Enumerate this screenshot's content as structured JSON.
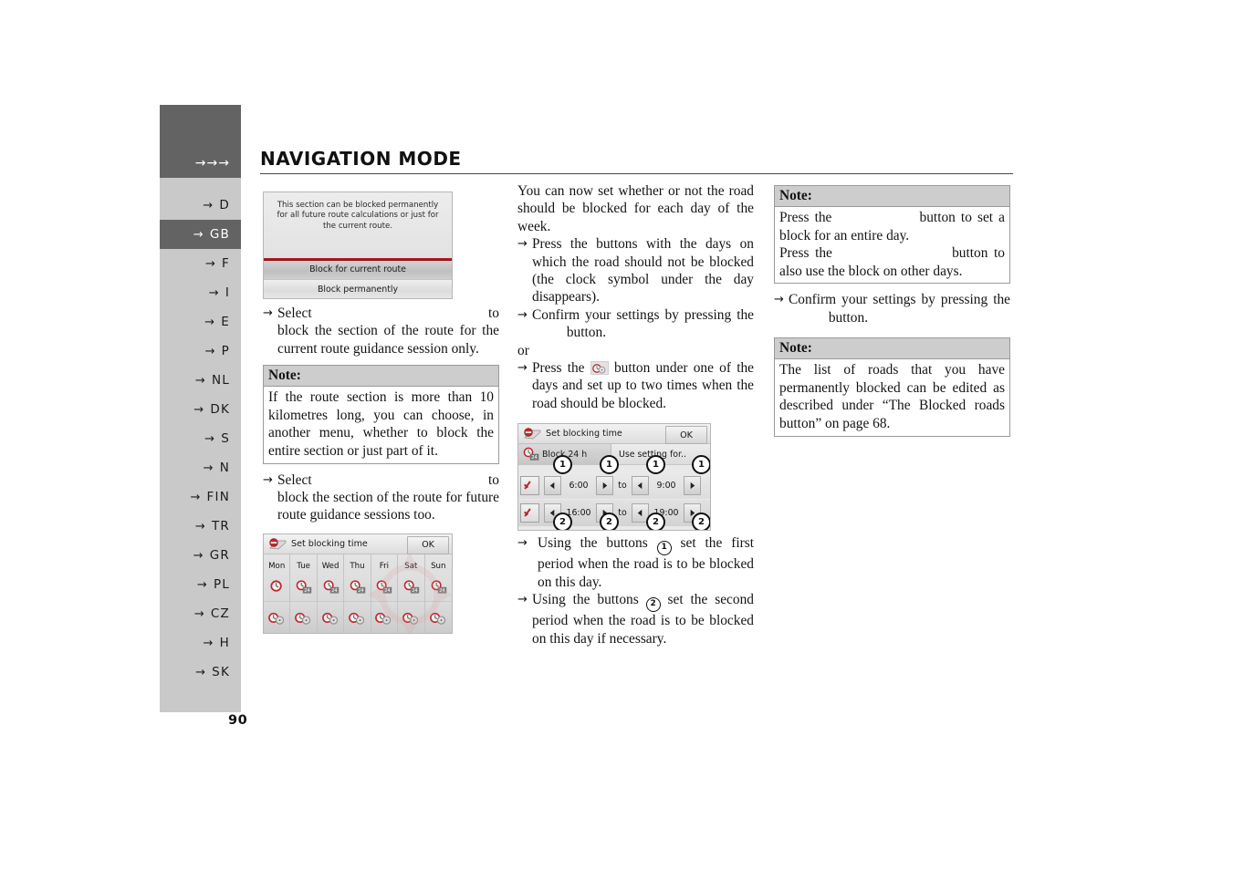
{
  "page": {
    "number": "90",
    "title": "NAVIGATION MODE",
    "header_arrows": "→→→"
  },
  "sidebar": {
    "languages": [
      {
        "code": "D",
        "active": false
      },
      {
        "code": "GB",
        "active": true
      },
      {
        "code": "F",
        "active": false
      },
      {
        "code": "I",
        "active": false
      },
      {
        "code": "E",
        "active": false
      },
      {
        "code": "P",
        "active": false
      },
      {
        "code": "NL",
        "active": false
      },
      {
        "code": "DK",
        "active": false
      },
      {
        "code": "S",
        "active": false
      },
      {
        "code": "N",
        "active": false
      },
      {
        "code": "FIN",
        "active": false
      },
      {
        "code": "TR",
        "active": false
      },
      {
        "code": "GR",
        "active": false
      },
      {
        "code": "PL",
        "active": false
      },
      {
        "code": "CZ",
        "active": false
      },
      {
        "code": "H",
        "active": false
      },
      {
        "code": "SK",
        "active": false
      }
    ],
    "arrow": "→"
  },
  "left_column": {
    "screenshot_block_dialog": {
      "message": "This section can be blocked permanently for all future route calculations or just for the current route.",
      "button_current": "Block for current route",
      "button_permanent": "Block permanently",
      "accent_color": "#a8161c"
    },
    "step_select_current": "to block the section of the route for the current route guidance session only.",
    "step_select_current_lead": "Select",
    "note_1": {
      "heading": "Note:",
      "body": "If the route section is more than 10 kilometres long, you can choose, in another menu, whether to block the entire section or just part of it."
    },
    "step_select_permanent_lead": "Select",
    "step_select_permanent": "to block the section of the route for future route guidance sessions too.",
    "screenshot_weekdays": {
      "title": "Set blocking time",
      "ok_label": "OK",
      "days": [
        "Mon",
        "Tue",
        "Wed",
        "Thu",
        "Fri",
        "Sat",
        "Sun"
      ],
      "top_row_badges": [
        "",
        "24",
        "24",
        "24",
        "24",
        "24",
        "24"
      ]
    }
  },
  "middle_column": {
    "intro": "You can now set whether or not the road should be blocked for each day of the week.",
    "step_press_days": "Press the buttons with the days on which the road should not be blocked (the clock symbol under the day disappears).",
    "step_confirm": "Confirm your settings by pressing the",
    "step_confirm_tail": "button.",
    "or_label": "or",
    "step_press_icon_lead": "Press the",
    "step_press_icon_tail": "button under one of the days and set up to two times when the road should be blocked.",
    "screenshot_times": {
      "title": "Set blocking time",
      "ok_label": "OK",
      "block_24h_label": "Block 24 h",
      "block_24h_badge": "24",
      "use_setting_label": "Use setting for..",
      "to_label": "to",
      "row1": {
        "from": "6:00",
        "to": "9:00",
        "checked": true,
        "callout": "1"
      },
      "row2": {
        "from": "16:00",
        "to": "19:00",
        "checked": true,
        "callout": "2"
      }
    },
    "step_period_1_lead": "Using the buttons",
    "step_period_1_badge": "1",
    "step_period_1_tail": "set the first period when the road is to be blocked on this day.",
    "step_period_2_lead": "Using the buttons",
    "step_period_2_badge": "2",
    "step_period_2_tail": "set the second period when the road is to be blocked on this day if necessary."
  },
  "right_column": {
    "note_1": {
      "heading": "Note:",
      "line1_lead": "Press the",
      "line1_tail": "button to set a block for an entire day.",
      "line2_lead": "Press the",
      "line2_tail": "button to also use the block on other days."
    },
    "confirm_step": "Confirm your settings by pressing the",
    "confirm_step_tail": "button.",
    "note_2": {
      "heading": "Note:",
      "body": "The list of roads that you have permanently blocked can be edited as described under “The Blocked roads button” on page 68."
    }
  }
}
